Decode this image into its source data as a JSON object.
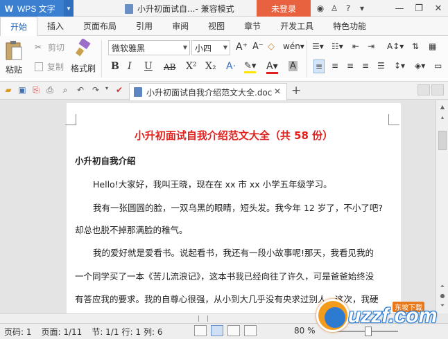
{
  "titlebar": {
    "app_name": "WPS 文字",
    "doc_title": "小升初面试自...- 兼容模式",
    "login": "未登录"
  },
  "tabs": [
    "开始",
    "插入",
    "页面布局",
    "引用",
    "审阅",
    "视图",
    "章节",
    "开发工具",
    "特色功能"
  ],
  "ribbon": {
    "paste": "粘贴",
    "cut": "剪切",
    "copy": "复制",
    "format_painter": "格式刷",
    "font_name": "微软雅黑",
    "font_size": "小四",
    "bold": "B",
    "italic": "I",
    "underline": "U",
    "strike": "AB",
    "superscript": "X²",
    "subscript": "X₂"
  },
  "doc_tab": {
    "name": "小升初面试自我介绍范文大全.doc"
  },
  "document": {
    "heading": "小升初面试自我介绍范文大全（共 58 份）",
    "subheading": "小升初自我介绍",
    "lines": [
      "Hello!大家好，我叫王晓，现在在 xx 市 xx 小学五年级学习。",
      "我有一张圆圆的脸，一双乌黑的眼睛，短头发。我今年 12 岁了，不小了吧?",
      "却总也脱不掉那满脸的稚气。",
      "我的爱好就是爱看书。说起看书，我还有一段小故事呢!那天，我看见我的",
      "一个同学买了一本《苦儿流浪记》，这本书我已经向往了许久，可是爸爸始终没",
      "有答应我的要求。我的自尊心很强，从小到大几乎没有央求过别人，这次，我硬"
    ]
  },
  "status": {
    "page": "页码: 1",
    "pages": "页面: 1/11",
    "section": "节: 1/1",
    "row": "行: 1",
    "col": "列: 6",
    "zoom": "80 %",
    "zoom_level": 0.8
  },
  "watermark": {
    "text": "uzzf.com",
    "small": "东坡下载"
  }
}
